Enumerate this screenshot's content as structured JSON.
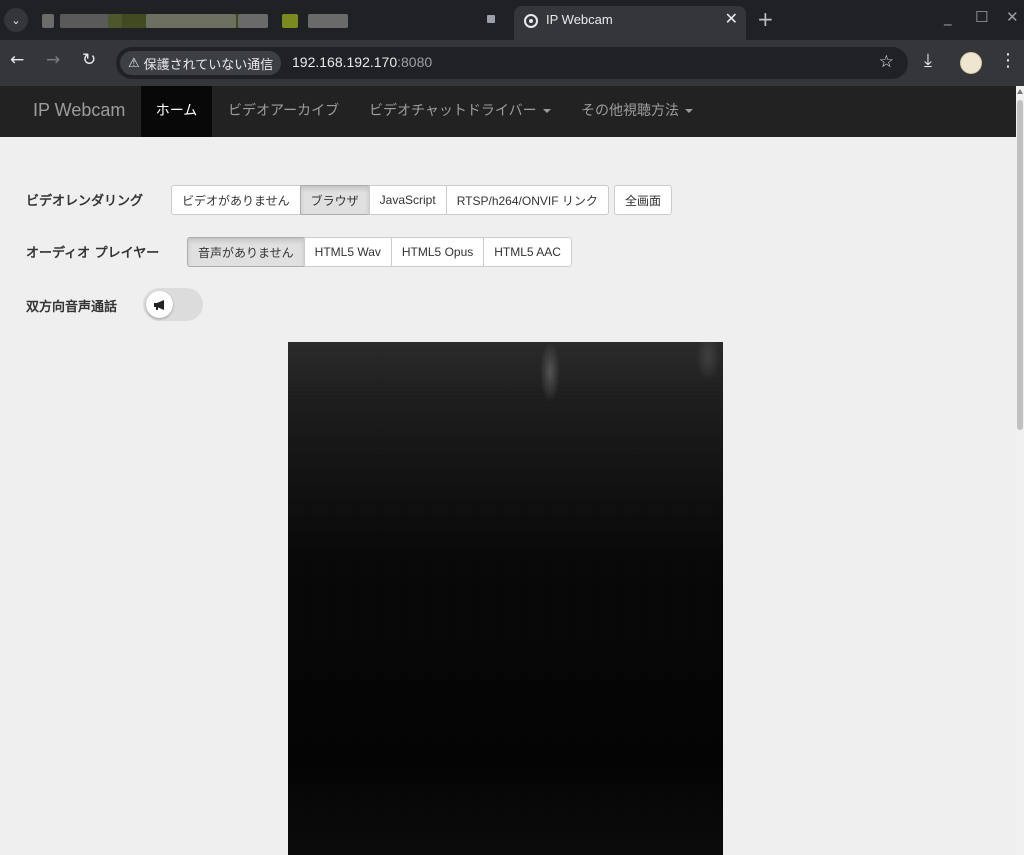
{
  "browser": {
    "active_tab_title": "IP Webcam",
    "security_label": "保護されていない通信",
    "url_host": "192.168.192.170",
    "url_port": ":8080"
  },
  "navbar": {
    "brand": "IP Webcam",
    "items": [
      {
        "label": "ホーム",
        "active": true
      },
      {
        "label": "ビデオアーカイブ"
      },
      {
        "label": "ビデオチャットドライバー"
      },
      {
        "label": "その他視聴方法"
      }
    ]
  },
  "video_rendering": {
    "label": "ビデオレンダリング",
    "options": [
      "ビデオがありません",
      "ブラウザ",
      "JavaScript",
      "RTSP/h264/ONVIF リンク"
    ],
    "selected": "ブラウザ",
    "fullscreen_label": "全画面"
  },
  "audio_player": {
    "label": "オーディオ プレイヤー",
    "options": [
      "音声がありません",
      "HTML5 Wav",
      "HTML5 Opus",
      "HTML5 AAC"
    ],
    "selected": "音声がありません"
  },
  "two_way_audio": {
    "label": "双方向音声通話",
    "enabled": false,
    "icon": "megaphone-icon"
  },
  "colors": {
    "navbar_bg": "#222222",
    "navbar_active_bg": "#080808",
    "page_bg": "#efefef"
  }
}
